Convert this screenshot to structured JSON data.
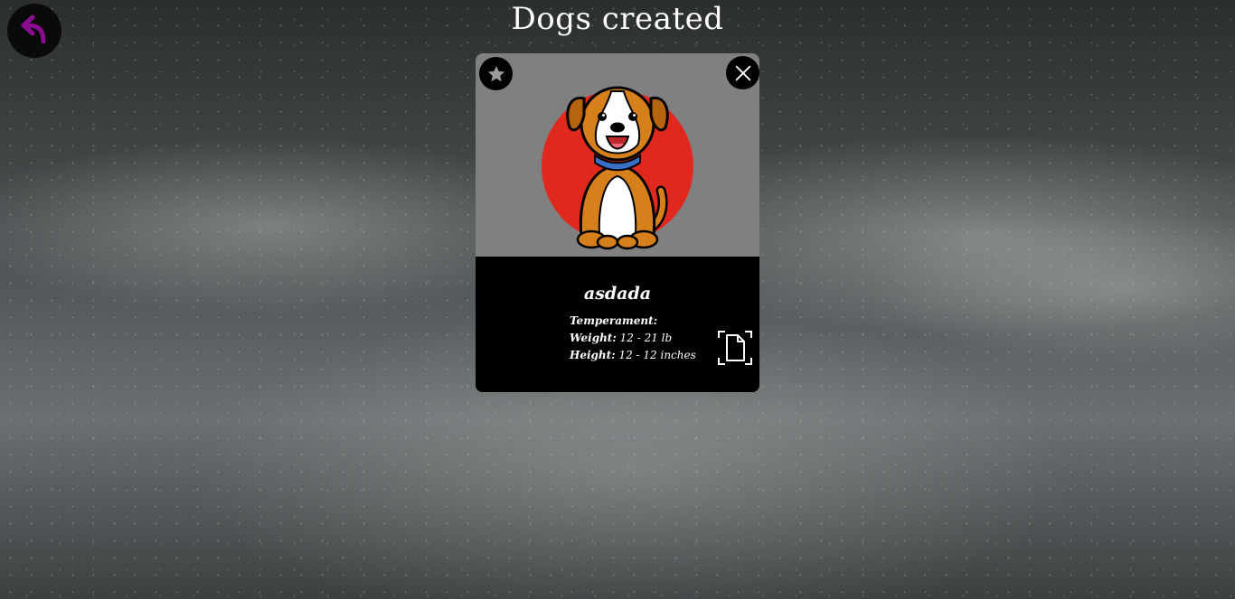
{
  "header": {
    "title": "Dogs created"
  },
  "nav": {
    "back_icon": "undo-arrow-icon",
    "back_color": "#8a0c8f"
  },
  "card": {
    "name": "asdada",
    "temperament_label": "Temperament:",
    "temperament_value": "",
    "weight_label": "Weight:",
    "weight_value": "12 - 21 lb",
    "height_label": "Height:",
    "height_value": "12 - 12 inches",
    "favorite_icon": "star-icon",
    "close_icon": "close-icon",
    "detail_icon": "document-icon",
    "image_bg": "#808080",
    "accent_circle": "#e0281e"
  }
}
